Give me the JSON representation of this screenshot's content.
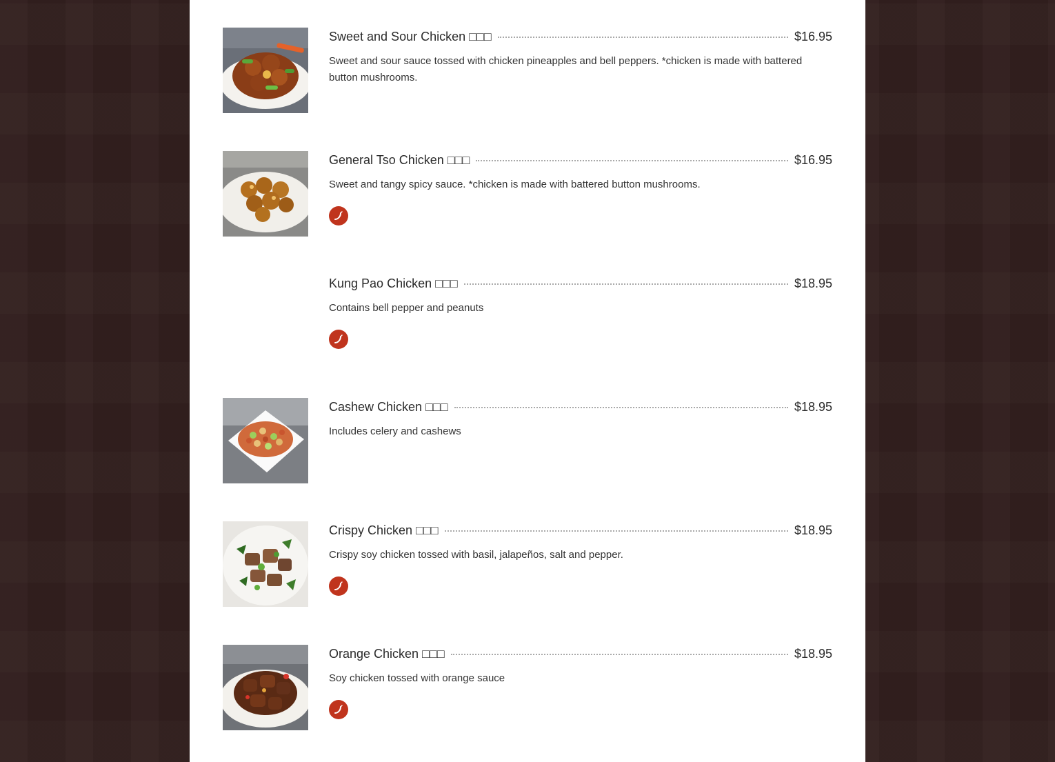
{
  "colors": {
    "background": "#33201f",
    "panel": "#ffffff",
    "spicy_badge": "#c0341d",
    "text": "#333333"
  },
  "menu": {
    "items": [
      {
        "name": "Sweet and Sour Chicken □□□",
        "price": "$16.95",
        "description": "Sweet and sour sauce tossed with chicken pineapples and bell peppers. *chicken is made with battered button mushrooms.",
        "has_image": true,
        "spicy": false,
        "spicy_icon": "chili-pepper-icon"
      },
      {
        "name": "General Tso Chicken □□□",
        "price": "$16.95",
        "description": "Sweet and tangy spicy sauce. *chicken is made with battered button mushrooms.",
        "has_image": true,
        "spicy": true,
        "spicy_icon": "chili-pepper-icon"
      },
      {
        "name": "Kung Pao Chicken □□□",
        "price": "$18.95",
        "description": "Contains bell pepper and peanuts",
        "has_image": false,
        "spicy": true,
        "spicy_icon": "chili-pepper-icon"
      },
      {
        "name": "Cashew Chicken □□□",
        "price": "$18.95",
        "description": "Includes celery and cashews",
        "has_image": true,
        "spicy": false,
        "spicy_icon": "chili-pepper-icon"
      },
      {
        "name": "Crispy Chicken □□□",
        "price": "$18.95",
        "description": "Crispy soy chicken tossed with basil, jalapeños, salt and pepper.",
        "has_image": true,
        "spicy": true,
        "spicy_icon": "chili-pepper-icon"
      },
      {
        "name": "Orange Chicken □□□",
        "price": "$18.95",
        "description": "Soy chicken tossed with orange sauce",
        "has_image": true,
        "spicy": true,
        "spicy_icon": "chili-pepper-icon"
      }
    ]
  }
}
